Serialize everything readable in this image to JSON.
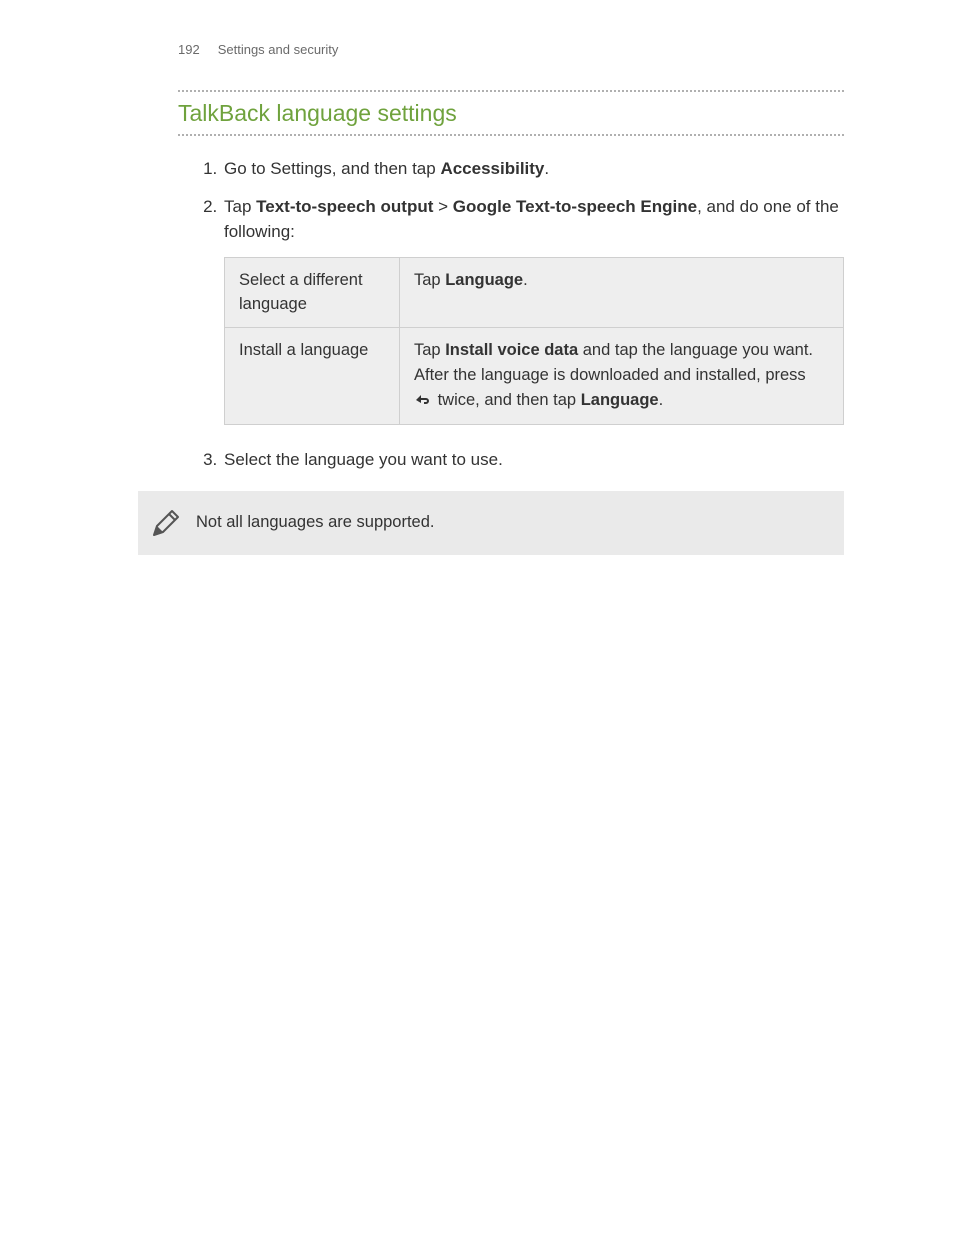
{
  "header": {
    "page_number": "192",
    "section": "Settings and security"
  },
  "title": "TalkBack language settings",
  "steps": {
    "s1": {
      "p1": "Go to Settings, and then tap ",
      "b1": "Accessibility",
      "p2": "."
    },
    "s2": {
      "p1": "Tap ",
      "b1": "Text-to-speech output",
      "p2": " > ",
      "b2": "Google Text-to-speech Engine",
      "p3": ", and do one of the following:"
    },
    "s3": "Select the language you want to use."
  },
  "table": {
    "r1": {
      "label": "Select a different language",
      "c1": "Tap ",
      "b1": "Language",
      "c2": "."
    },
    "r2": {
      "label": "Install a language",
      "c1": "Tap ",
      "b1": "Install voice data",
      "c2": " and tap the language you want. After the language is downloaded and installed, press ",
      "c3": " twice, and then tap ",
      "b2": "Language",
      "c4": "."
    }
  },
  "note": "Not all languages are supported."
}
